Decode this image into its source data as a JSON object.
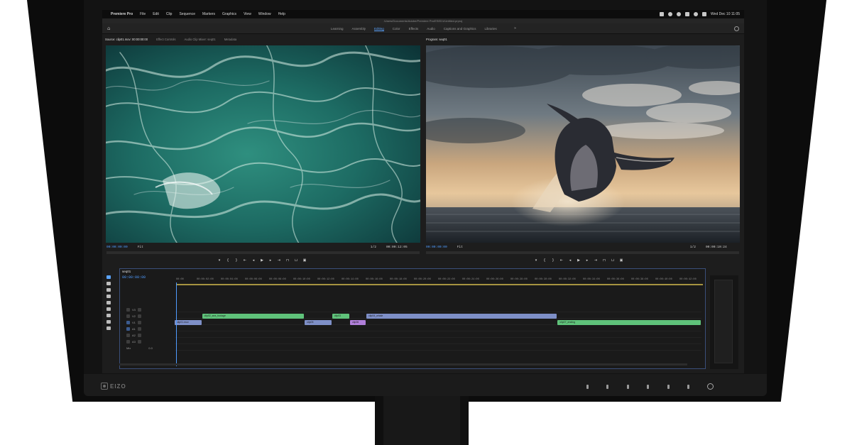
{
  "menubar": {
    "app_name": "Premiere Pro",
    "items": [
      "File",
      "Edit",
      "Clip",
      "Sequence",
      "Markers",
      "Graphics",
      "View",
      "Window",
      "Help"
    ],
    "clock": "Wed Dec 10  11:05"
  },
  "window": {
    "path": "/Users/Documents/Adobe/Premiere Pro/ESED1/Untitled.prproj"
  },
  "workspaces": {
    "tabs": [
      "Learning",
      "Assembly",
      "Editing",
      "Color",
      "Effects",
      "Audio",
      "Captions and Graphics",
      "Libraries"
    ],
    "active": "Editing",
    "more": "»"
  },
  "source_panel": {
    "tabs": [
      "Source: clip01.mov: 00:00:00:00",
      "Effect Controls",
      "Audio Clip Mixer: seq01",
      "Metadata"
    ],
    "timecode": "00:00:00:00",
    "duration": "00:00:12:05",
    "fit": "Fit",
    "res": "1/2"
  },
  "program_panel": {
    "tabs": [
      "Program: seq01"
    ],
    "timecode": "00:00:00:00",
    "duration": "00:00:10:24",
    "fit": "Fit",
    "res": "1/2"
  },
  "transport_icons": [
    "marker",
    "in",
    "out",
    "go-to-in",
    "step-back",
    "play",
    "step-forward",
    "go-to-out",
    "insert",
    "overwrite",
    "export-frame"
  ],
  "timeline": {
    "sequence_name": "seq01",
    "timecode": "00:00:00:00",
    "ruler": [
      "00:00",
      "00:00:02:00",
      "00:00:04:00",
      "00:00:06:00",
      "00:00:08:00",
      "00:00:10:00",
      "00:00:12:00",
      "00:00:14:00",
      "00:00:16:00",
      "00:00:18:00",
      "00:00:20:00",
      "00:00:22:00",
      "00:00:24:00",
      "00:00:26:00",
      "00:00:28:00",
      "00:00:30:00",
      "00:00:32:00",
      "00:00:34:00",
      "00:00:36:00",
      "00:00:38:00",
      "00:00:40:00",
      "00:00:42:00"
    ],
    "tracks": [
      "V3",
      "V2",
      "V1",
      "A1",
      "A2",
      "A3",
      "Mix"
    ],
    "mix_value": "0.0",
    "clips": [
      {
        "label": "clip02_sea_footage",
        "color": "#5fc27a",
        "track": 1,
        "start": 0.052,
        "end": 0.247
      },
      {
        "label": "clip03",
        "color": "#5fc27a",
        "track": 1,
        "start": 0.299,
        "end": 0.333
      },
      {
        "label": "clip04_whale",
        "color": "#7e8fc7",
        "track": 1,
        "start": 0.364,
        "end": 0.727
      },
      {
        "label": "clip01.mov",
        "color": "#7e8fc7",
        "track": 2,
        "start": 0.0,
        "end": 0.052
      },
      {
        "label": "clip05",
        "color": "#7e8fc7",
        "track": 2,
        "start": 0.247,
        "end": 0.299
      },
      {
        "label": "clip06",
        "color": "#b07fd9",
        "track": 2,
        "start": 0.333,
        "end": 0.364
      },
      {
        "label": "clip07_ending",
        "color": "#5fc27a",
        "track": 2,
        "start": 0.727,
        "end": 1.0
      }
    ]
  },
  "hardware": {
    "brand": "EIZO"
  },
  "colors": {
    "accent": "#4f9cff",
    "clip_green": "#5fc27a",
    "clip_blue": "#7e8fc7",
    "clip_purple": "#b07fd9"
  }
}
